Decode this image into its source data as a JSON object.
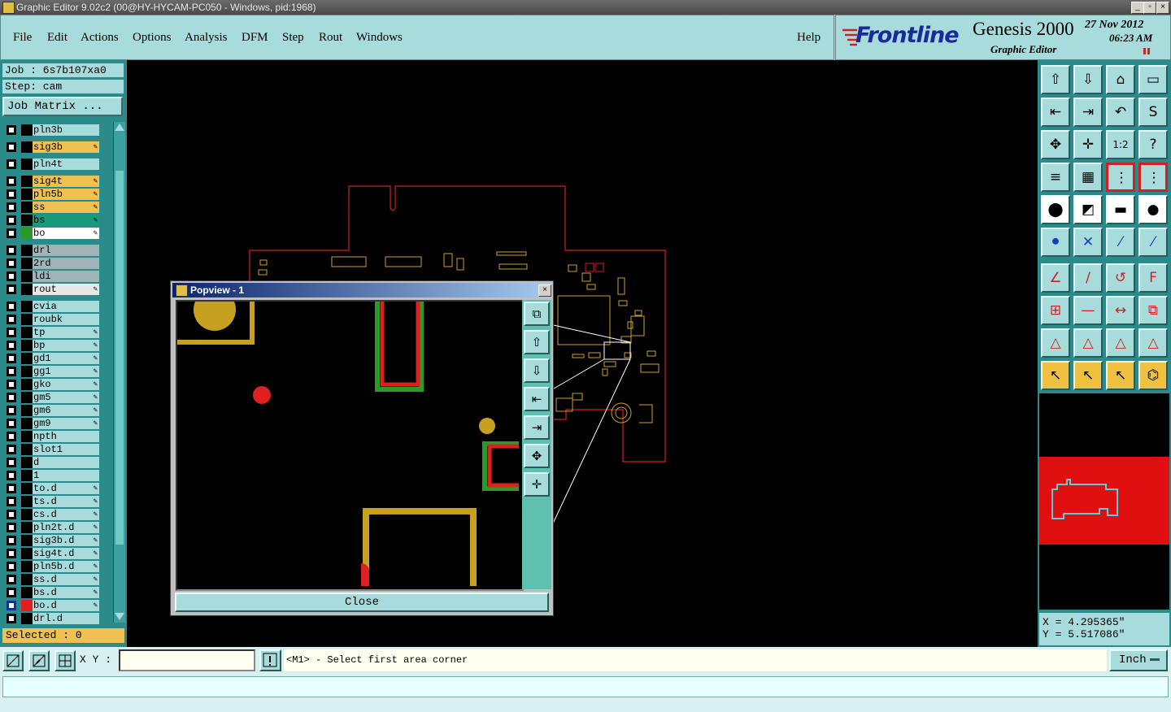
{
  "window": {
    "title": "Graphic Editor 9.02c2 (00@HY-HYCAM-PC050 - Windows, pid:1968)"
  },
  "menu": {
    "items": [
      "File",
      "Edit",
      "Actions",
      "Options",
      "Analysis",
      "DFM",
      "Step",
      "Rout",
      "Windows"
    ],
    "help": "Help"
  },
  "brand": {
    "logo": "Frontline",
    "product": "Genesis 2000",
    "subtitle": "Graphic Editor",
    "date": "27 Nov 2012",
    "time": "06:23 AM"
  },
  "job": {
    "job_label": "Job : 6s7b107xa0",
    "step_label": "Step: cam",
    "matrix_button": "Job Matrix ..."
  },
  "layers": [
    {
      "name": "pln3b",
      "color": "#a8dcdc",
      "marker": "#000000",
      "edit": false
    },
    {
      "name": "sig3b",
      "color": "#f0c050",
      "marker": "#000000",
      "edit": true
    },
    {
      "name": "pln4t",
      "color": "#a8dcdc",
      "marker": "#000000",
      "edit": false
    },
    {
      "name": "sig4t",
      "color": "#f0c050",
      "marker": "#000000",
      "edit": true
    },
    {
      "name": "pln5b",
      "color": "#f0c050",
      "marker": "#000000",
      "edit": true
    },
    {
      "name": "ss",
      "color": "#f0c050",
      "marker": "#000000",
      "edit": true
    },
    {
      "name": "bs",
      "color": "#1a9a7a",
      "marker": "#000000",
      "edit": true
    },
    {
      "name": "bo",
      "color": "#ffffff",
      "marker": "#2a9a2a",
      "edit": true
    },
    {
      "name": "drl",
      "color": "#a0b4b8",
      "marker": "#000000",
      "edit": false
    },
    {
      "name": "2rd",
      "color": "#a0b4b8",
      "marker": "#000000",
      "edit": false
    },
    {
      "name": "ldi",
      "color": "#a0b4b8",
      "marker": "#000000",
      "edit": false
    },
    {
      "name": "rout",
      "color": "#e8e8e8",
      "marker": "#000000",
      "edit": true
    },
    {
      "name": "cvia",
      "color": "#a8dcdc",
      "marker": "#000000",
      "edit": false
    },
    {
      "name": "roubk",
      "color": "#a8dcdc",
      "marker": "#000000",
      "edit": false
    },
    {
      "name": "tp",
      "color": "#a8dcdc",
      "marker": "#000000",
      "edit": true
    },
    {
      "name": "bp",
      "color": "#a8dcdc",
      "marker": "#000000",
      "edit": true
    },
    {
      "name": "gd1",
      "color": "#a8dcdc",
      "marker": "#000000",
      "edit": true
    },
    {
      "name": "gg1",
      "color": "#a8dcdc",
      "marker": "#000000",
      "edit": true
    },
    {
      "name": "gko",
      "color": "#a8dcdc",
      "marker": "#000000",
      "edit": true
    },
    {
      "name": "gm5",
      "color": "#a8dcdc",
      "marker": "#000000",
      "edit": true
    },
    {
      "name": "gm6",
      "color": "#a8dcdc",
      "marker": "#000000",
      "edit": true
    },
    {
      "name": "gm9",
      "color": "#a8dcdc",
      "marker": "#000000",
      "edit": true
    },
    {
      "name": "npth",
      "color": "#a8dcdc",
      "marker": "#000000",
      "edit": false
    },
    {
      "name": "slot1",
      "color": "#a8dcdc",
      "marker": "#000000",
      "edit": false
    },
    {
      "name": "d",
      "color": "#a8dcdc",
      "marker": "#000000",
      "edit": false
    },
    {
      "name": "1",
      "color": "#a8dcdc",
      "marker": "#000000",
      "edit": false
    },
    {
      "name": "to.d",
      "color": "#a8dcdc",
      "marker": "#000000",
      "edit": true
    },
    {
      "name": "ts.d",
      "color": "#a8dcdc",
      "marker": "#000000",
      "edit": true
    },
    {
      "name": "cs.d",
      "color": "#a8dcdc",
      "marker": "#000000",
      "edit": true
    },
    {
      "name": "pln2t.d",
      "color": "#a8dcdc",
      "marker": "#000000",
      "edit": true
    },
    {
      "name": "sig3b.d",
      "color": "#a8dcdc",
      "marker": "#000000",
      "edit": true
    },
    {
      "name": "sig4t.d",
      "color": "#a8dcdc",
      "marker": "#000000",
      "edit": true
    },
    {
      "name": "pln5b.d",
      "color": "#a8dcdc",
      "marker": "#000000",
      "edit": true
    },
    {
      "name": "ss.d",
      "color": "#a8dcdc",
      "marker": "#000000",
      "edit": true
    },
    {
      "name": "bs.d",
      "color": "#a8dcdc",
      "marker": "#000000",
      "edit": true
    },
    {
      "name": "bo.d",
      "color": "#a8dcdc",
      "marker": "#e02020",
      "edit": true
    },
    {
      "name": "drl.d",
      "color": "#a8dcdc",
      "marker": "#000000",
      "edit": false
    }
  ],
  "selected_label": "Selected : 0",
  "popview": {
    "title": "Popview - 1",
    "close_label": "Close"
  },
  "toolbar_icons": [
    "zoom-home-icon",
    "zoom-page-icon",
    "home-icon",
    "split-view-icon",
    "pan-left-icon",
    "pan-right-icon",
    "undo-icon",
    "redraw-icon",
    "fit-icon",
    "center-icon",
    "scale-icon",
    "help-icon",
    "settings-icon",
    "grid-icon",
    "snap-icon",
    "snap-alt-icon",
    "select-icon",
    "measure-icon",
    "ruler-icon",
    "pad-icon",
    "connect-icon",
    "cross-icon",
    "line-icon",
    "arc-icon",
    "angle-icon",
    "slash-icon",
    "curve-icon",
    "text-icon",
    "feature-icon",
    "minus-icon",
    "dimension-icon",
    "shape-icon",
    "triangle-icon",
    "triangle-alt-icon",
    "triangle-a-icon",
    "triangle-b-icon",
    "pointer-icon",
    "pointer-box-icon",
    "pointer-alt-icon",
    "pointer-net-icon"
  ],
  "coords": {
    "x_label": "X = 4.295365\"",
    "y_label": "Y = 5.517086\""
  },
  "bottom": {
    "xy_label": "X Y :",
    "xy_value": "",
    "status": "<M1> - Select first area corner",
    "unit": "Inch"
  }
}
